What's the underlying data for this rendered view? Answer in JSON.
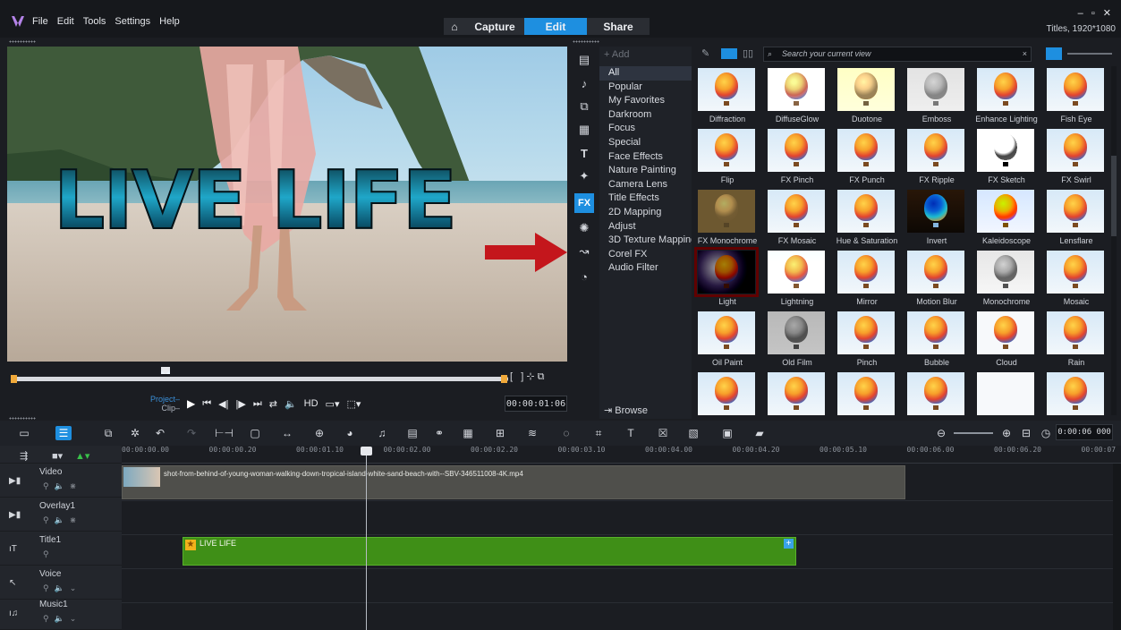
{
  "menu": [
    "File",
    "Edit",
    "Tools",
    "Settings",
    "Help"
  ],
  "tabs": {
    "capture": "Capture",
    "edit": "Edit",
    "share": "Share"
  },
  "window_controls": "– ▫ ✕",
  "project_info": "Titles, 1920*1080",
  "preview": {
    "overlay_text": "LIVE LIFE"
  },
  "player": {
    "project_label": "Project–",
    "clip_label": "Clip–",
    "hd_label": "HD",
    "timecode": "00:00:01:06"
  },
  "library": {
    "add_label": "Add",
    "categories": [
      "All",
      "Popular",
      "My Favorites",
      "Darkroom",
      "Focus",
      "Special",
      "Face Effects",
      "Nature Painting",
      "Camera Lens",
      "Title Effects",
      "2D Mapping",
      "Adjust",
      "3D Texture Mapping",
      "Corel FX",
      "Audio Filter"
    ],
    "selected_category": "All",
    "browse_label": "Browse",
    "search_placeholder": "Search your current view",
    "effects": [
      "Diffraction",
      "DiffuseGlow",
      "Duotone",
      "Emboss",
      "Enhance Lighting",
      "Fish Eye",
      "Flip",
      "FX Pinch",
      "FX Punch",
      "FX Ripple",
      "FX Sketch",
      "FX Swirl",
      "FX Monochrome",
      "FX Mosaic",
      "Hue & Saturation",
      "Invert",
      "Kaleidoscope",
      "Lensflare",
      "Light",
      "Lightning",
      "Mirror",
      "Motion Blur",
      "Monochrome",
      "Mosaic",
      "Oil Paint",
      "Old Film",
      "Pinch",
      "Bubble",
      "Cloud",
      "Rain",
      "",
      "",
      "",
      "",
      "",
      ""
    ],
    "selected_effect": "Light"
  },
  "timeline": {
    "zoom_timecode": "0:00:06 000",
    "ruler": [
      "00:00:00.00",
      "00:00:00.20",
      "00:00:01.10",
      "00:00:02.00",
      "00:00:02.20",
      "00:00:03.10",
      "00:00:04.00",
      "00:00:04.20",
      "00:00:05.10",
      "00:00:06.00",
      "00:00:06.20",
      "00:00:07"
    ],
    "tracks": [
      "Video",
      "Overlay1",
      "Title1",
      "Voice",
      "Music1"
    ],
    "video_clip_name": "shot-from-behind-of-young-woman-walking-down-tropical-island-white-sand-beach-with--SBV-346511008-4K.mp4",
    "title_clip_name": "LIVE LIFE"
  },
  "colors": {
    "accent": "#1e8fe0",
    "title_clip": "#3f8f17",
    "selection": "#b01e23",
    "arrow": "#c4161c"
  }
}
